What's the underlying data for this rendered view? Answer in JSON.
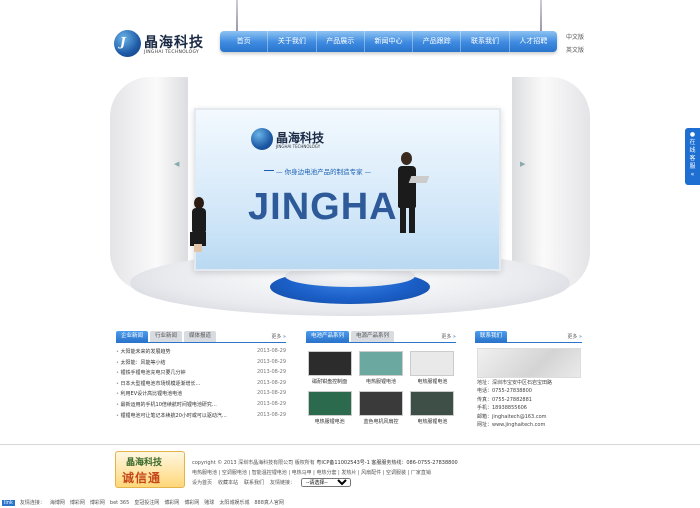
{
  "logo": {
    "cn": "晶海科技",
    "en": "JINGHAI TECHNOLOGY",
    "mark": "J"
  },
  "nav": [
    "首页",
    "关于我们",
    "产品展示",
    "新闻中心",
    "产品跟踪",
    "联系我们",
    "人才招聘"
  ],
  "lang": [
    "中文版",
    "英文版"
  ],
  "banner": {
    "cn": "晶海科技",
    "en": "JINGHAI TECHNOLOGY",
    "slogan": "— 你身边电池产品的制造专家 —",
    "big": "JINGHAI"
  },
  "side_tab": {
    "chars": [
      "在",
      "线",
      "客",
      "服"
    ],
    "arrow": "«"
  },
  "news": {
    "tabs": [
      "企业新闻",
      "行业新闻",
      "媒体报道"
    ],
    "more": "更多",
    "items": [
      {
        "title": "大阳能未来的发展趋势",
        "date": "2013-08-29"
      },
      {
        "title": "太阳能：风能等小结",
        "date": "2013-08-29"
      },
      {
        "title": "锂铁手锂电池充电只要几分钟",
        "date": "2013-08-29"
      },
      {
        "title": "日本大型锂电池市场规模逐渐增长…",
        "date": "2013-08-29"
      },
      {
        "title": "利用EV设计高比锂电池电池",
        "date": "2013-08-29"
      },
      {
        "title": "最新运用的手机10倍续航时间锂电池研究…",
        "date": "2013-08-29"
      },
      {
        "title": "锂锂电池可让笔记本续航20小时或可以驱动汽…",
        "date": "2013-08-29"
      }
    ]
  },
  "products": {
    "tabs": [
      "电池产品系列",
      "电源产品系列"
    ],
    "more": "更多",
    "items": [
      {
        "caption": "磁耐钳盘控制面",
        "color": "#2c2c2c"
      },
      {
        "caption": "电热服锂电池",
        "color": "#6aa8a0"
      },
      {
        "caption": "电热服锂电池",
        "color": "#e9e9e9"
      },
      {
        "caption": "电热服锂电池",
        "color": "#2c6a4e"
      },
      {
        "caption": "蓝色电机风扇控",
        "color": "#3a3a3a"
      },
      {
        "caption": "电热服锂电池",
        "color": "#3d4f47"
      }
    ]
  },
  "contact": {
    "tab": "联系我们",
    "more": "更多",
    "lines": [
      "地址：深圳市宝安中区石岩宝田路",
      "电话：0755-27838800",
      "传真：0755-27882881",
      "手机：18938855606",
      "邮箱：jinghaitech@163.com",
      "网址：www.jinghaitech.com"
    ]
  },
  "footer": {
    "badge_a": "晶海科技",
    "badge_b": "诚信通",
    "copyright": "copyright © 2013 深圳市晶海科技有限公司 版权所有",
    "icp": "粤ICP备11002543号-1 客服服务热线：086-0755-27838800",
    "categories": "电热服电池 | 空调服电池 | 智能温控锂电池 | 电热马甲 | 电热分套 | 发热片 | 风扇配件 | 空调服装 | 厂家直销",
    "links": [
      "设为首页",
      "收藏本站",
      "联系我们"
    ],
    "friend_label": "友情链接：",
    "select_value": "--请选择--"
  },
  "friend_bar": {
    "label": "link",
    "text": "友情连接：",
    "links": [
      "海博网",
      "博彩网",
      "博彩网",
      "bet 365",
      "皇冠投注网",
      "博彩网",
      "博彩网",
      "赌球",
      "太阳城娱乐城",
      "888真人官网"
    ]
  },
  "colors": {
    "accent": "#2a74cc",
    "nav_grad_top": "#8ec3f2",
    "text": "#333333"
  }
}
